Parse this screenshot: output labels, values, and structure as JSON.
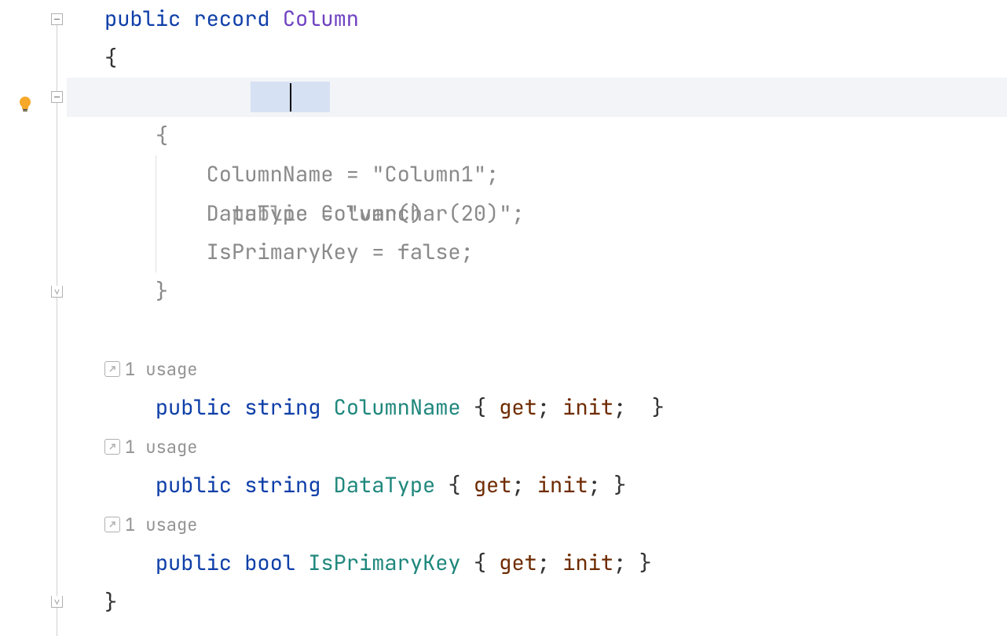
{
  "gutter": {
    "bulb_icon": "lightbulb"
  },
  "fold": {
    "markers": [
      "minus",
      "minus",
      "end",
      "end"
    ]
  },
  "usage": {
    "text1": "1 usage",
    "text2": "1 usage",
    "text3": "1 usage"
  },
  "code": {
    "l1_public": "public",
    "l1_record": "record",
    "l1_Column": "Column",
    "l2_brace": "{",
    "l3_public": "public",
    "l3_Column": "Column",
    "l3_parens": "()",
    "l4_brace": "{",
    "l5_ColumnName": "ColumnName",
    "l5_eq": " = ",
    "l5_str": "\"Column1\"",
    "l5_semi": ";",
    "l6_DataType": "DataType",
    "l6_eq": " = ",
    "l6_str": "\"varchar(20)\"",
    "l6_semi": ";",
    "l7_IsPrimaryKey": "IsPrimaryKey",
    "l7_eq": " = ",
    "l7_false": "false",
    "l7_semi": ";",
    "l8_brace": "}",
    "p1_public": "public",
    "p1_type": "string",
    "p1_name": "ColumnName",
    "p1_lb": " { ",
    "p1_get": "get",
    "p1_s1": "; ",
    "p1_init": "init",
    "p1_s2": ";  ",
    "p1_rb": "}",
    "p2_public": "public",
    "p2_type": "string",
    "p2_name": "DataType",
    "p2_lb": " { ",
    "p2_get": "get",
    "p2_s1": "; ",
    "p2_init": "init",
    "p2_s2": "; ",
    "p2_rb": "}",
    "p3_public": "public",
    "p3_type": "bool",
    "p3_name": "IsPrimaryKey",
    "p3_lb": " { ",
    "p3_get": "get",
    "p3_s1": "; ",
    "p3_init": "init",
    "p3_s2": "; ",
    "p3_rb": "}",
    "lend_brace": "}"
  }
}
